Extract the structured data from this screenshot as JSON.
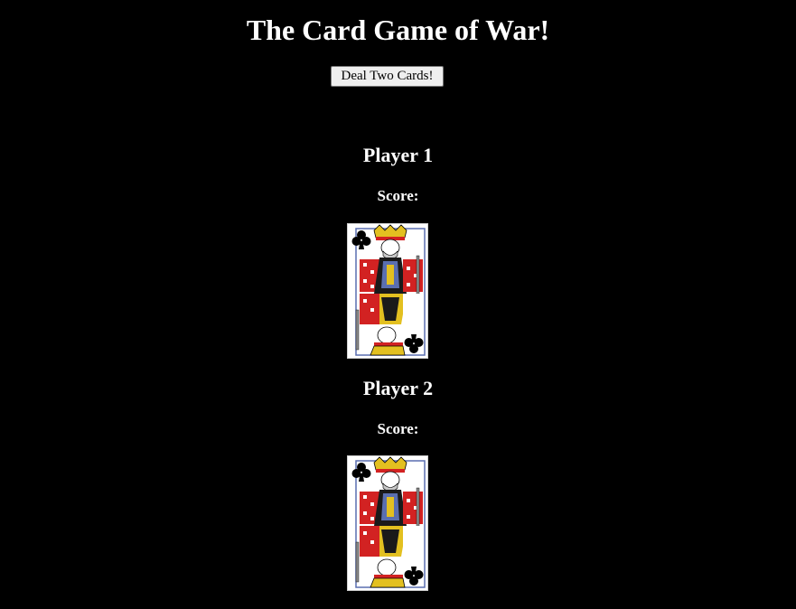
{
  "game": {
    "title": "The Card Game of War!",
    "deal_button_label": "Deal Two Cards!"
  },
  "players": [
    {
      "name": "Player 1",
      "score_label": "Score:",
      "score_value": "",
      "card": {
        "rank": "K",
        "suit": "clubs",
        "suit_icon": "club-icon"
      }
    },
    {
      "name": "Player 2",
      "score_label": "Score:",
      "score_value": "",
      "card": {
        "rank": "K",
        "suit": "clubs",
        "suit_icon": "club-icon"
      }
    }
  ],
  "colors": {
    "background": "#000000",
    "text": "#ffffff",
    "card_face": "#ffffff",
    "card_red": "#d22222",
    "card_gold": "#e3c020",
    "card_blue": "#5a6fb0"
  }
}
